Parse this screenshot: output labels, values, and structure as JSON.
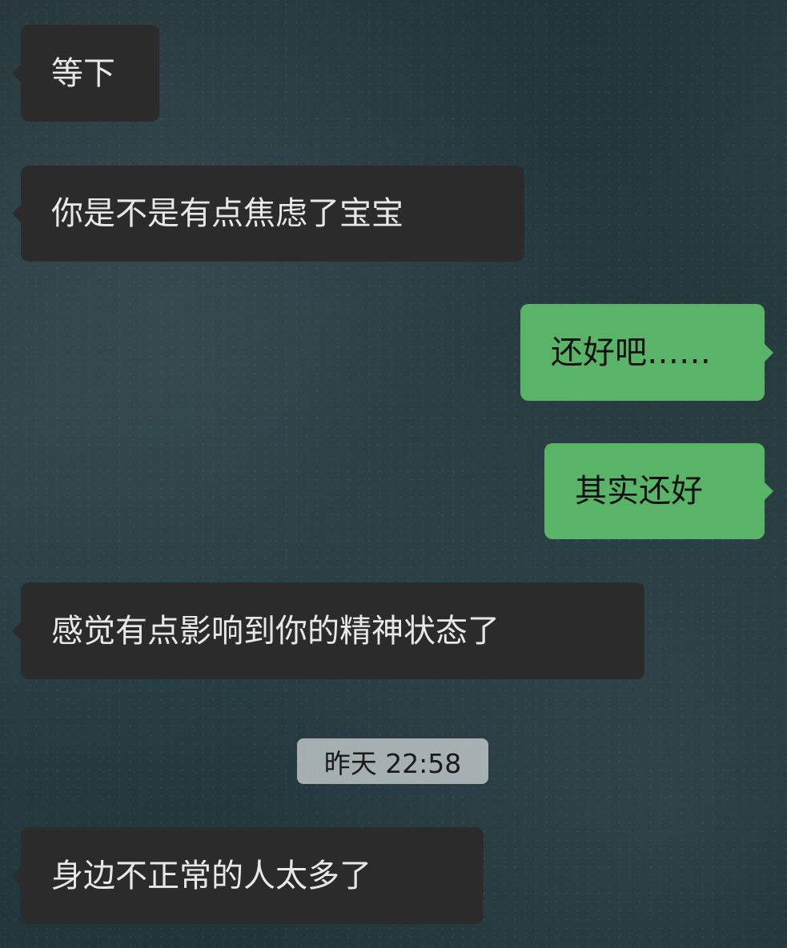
{
  "messages": [
    {
      "side": "left",
      "text": "等下"
    },
    {
      "side": "left",
      "text": "你是不是有点焦虑了宝宝"
    },
    {
      "side": "right",
      "text": "还好吧……"
    },
    {
      "side": "right",
      "text": "其实还好"
    },
    {
      "side": "left",
      "text": "感觉有点影响到你的精神状态了"
    },
    {
      "side": "left",
      "text": "身边不正常的人太多了"
    }
  ],
  "timestamp": "昨天 22:58",
  "colors": {
    "incoming_bubble": "#2b2b2b",
    "incoming_text": "#e8e8e8",
    "outgoing_bubble": "#5ab467",
    "outgoing_text": "#111111",
    "timestamp_bg": "#d7dcde"
  }
}
